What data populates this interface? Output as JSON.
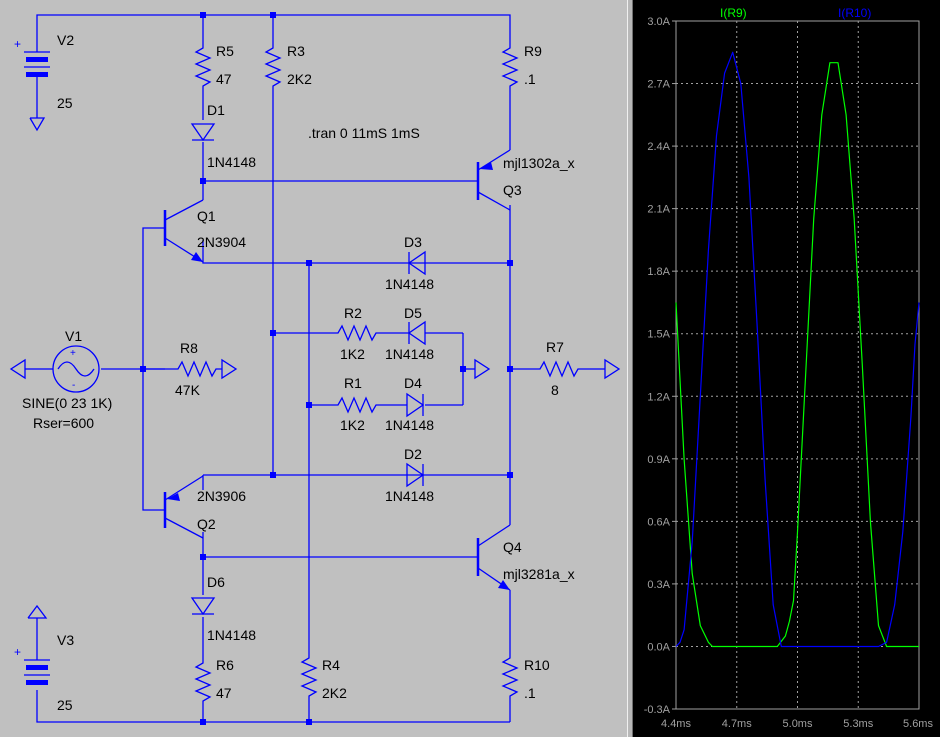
{
  "schematic": {
    "directive": ".tran 0 11mS 1mS",
    "components": {
      "V2": {
        "name": "V2",
        "value": "25"
      },
      "V3": {
        "name": "V3",
        "value": "25"
      },
      "V1": {
        "name": "V1",
        "value": "SINE(0 23 1K)",
        "extra": "Rser=600"
      },
      "R5": {
        "name": "R5",
        "value": "47"
      },
      "R3": {
        "name": "R3",
        "value": "2K2"
      },
      "R9": {
        "name": "R9",
        "value": ".1"
      },
      "D1": {
        "name": "D1",
        "value": "1N4148"
      },
      "Q1": {
        "name": "Q1",
        "value": "2N3904"
      },
      "Q3": {
        "name": "Q3",
        "value": "mjl1302a_x"
      },
      "D3": {
        "name": "D3",
        "value": "1N4148"
      },
      "R2": {
        "name": "R2",
        "value": "1K2"
      },
      "D5": {
        "name": "D5",
        "value": "1N4148"
      },
      "R8": {
        "name": "R8",
        "value": "47K"
      },
      "R7": {
        "name": "R7",
        "value": "8"
      },
      "R1": {
        "name": "R1",
        "value": "1K2"
      },
      "D4": {
        "name": "D4",
        "value": "1N4148"
      },
      "D2": {
        "name": "D2",
        "value": "1N4148"
      },
      "Q2": {
        "name": "Q2",
        "value": "2N3906"
      },
      "Q4": {
        "name": "Q4",
        "value": "mjl3281a_x"
      },
      "D6": {
        "name": "D6",
        "value": "1N4148"
      },
      "R6": {
        "name": "R6",
        "value": "47"
      },
      "R4": {
        "name": "R4",
        "value": "2K2"
      },
      "R10": {
        "name": "R10",
        "value": ".1"
      }
    }
  },
  "plot": {
    "colors": {
      "background": "#000000",
      "grid": "#a0a0a0",
      "r9": "#00ff00",
      "r10": "#0000ff",
      "wire": "#0000ff"
    },
    "chart_data": {
      "type": "line",
      "xlabel": "",
      "ylabel": "",
      "x_ticks": [
        "4.4ms",
        "4.7ms",
        "5.0ms",
        "5.3ms",
        "5.6ms"
      ],
      "y_ticks": [
        "3.0A",
        "2.7A",
        "2.4A",
        "2.1A",
        "1.8A",
        "1.5A",
        "1.2A",
        "0.9A",
        "0.6A",
        "0.3A",
        "0.0A",
        "-0.3A"
      ],
      "xlim": [
        4.4,
        5.6
      ],
      "ylim": [
        -0.3,
        3.0
      ],
      "grid": true,
      "series": [
        {
          "name": "I(R9)",
          "x": [
            4.4,
            4.44,
            4.48,
            4.52,
            4.56,
            4.58,
            4.62,
            4.66,
            4.7,
            4.74,
            4.78,
            4.82,
            4.86,
            4.9,
            4.94,
            4.96,
            4.98,
            5.0,
            5.04,
            5.08,
            5.12,
            5.16,
            5.2,
            5.24,
            5.28,
            5.32,
            5.36,
            5.4,
            5.44,
            5.48,
            5.52,
            5.56,
            5.6
          ],
          "y": [
            1.65,
            0.9,
            0.35,
            0.1,
            0.02,
            0.0,
            0.0,
            0.0,
            0.0,
            0.0,
            0.0,
            0.0,
            0.0,
            0.0,
            0.05,
            0.12,
            0.22,
            0.55,
            1.3,
            2.05,
            2.55,
            2.8,
            2.8,
            2.55,
            2.05,
            1.35,
            0.6,
            0.1,
            0.0,
            0.0,
            0.0,
            0.0,
            0.0
          ]
        },
        {
          "name": "I(R10)",
          "x": [
            4.4,
            4.42,
            4.44,
            4.48,
            4.52,
            4.56,
            4.6,
            4.64,
            4.68,
            4.72,
            4.76,
            4.8,
            4.84,
            4.88,
            4.92,
            4.96,
            5.0,
            5.04,
            5.08,
            5.12,
            5.16,
            5.2,
            5.24,
            5.28,
            5.32,
            5.36,
            5.4,
            5.44,
            5.48,
            5.52,
            5.56,
            5.58,
            5.6
          ],
          "y": [
            0.0,
            0.02,
            0.08,
            0.5,
            1.2,
            1.9,
            2.45,
            2.75,
            2.85,
            2.7,
            2.25,
            1.55,
            0.8,
            0.2,
            0.0,
            0.0,
            0.0,
            0.0,
            0.0,
            0.0,
            0.0,
            0.0,
            0.0,
            0.0,
            0.0,
            0.0,
            0.0,
            0.02,
            0.2,
            0.55,
            1.1,
            1.45,
            1.65
          ]
        }
      ]
    }
  }
}
